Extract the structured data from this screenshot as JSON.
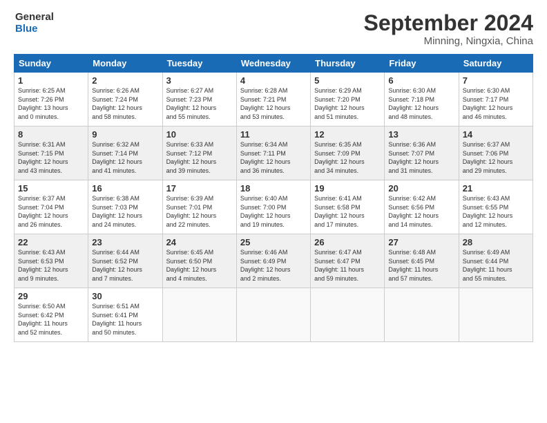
{
  "header": {
    "logo_line1": "General",
    "logo_line2": "Blue",
    "title": "September 2024",
    "location": "Minning, Ningxia, China"
  },
  "days_of_week": [
    "Sunday",
    "Monday",
    "Tuesday",
    "Wednesday",
    "Thursday",
    "Friday",
    "Saturday"
  ],
  "weeks": [
    [
      {
        "day": "1",
        "info": "Sunrise: 6:25 AM\nSunset: 7:26 PM\nDaylight: 13 hours\nand 0 minutes."
      },
      {
        "day": "2",
        "info": "Sunrise: 6:26 AM\nSunset: 7:24 PM\nDaylight: 12 hours\nand 58 minutes."
      },
      {
        "day": "3",
        "info": "Sunrise: 6:27 AM\nSunset: 7:23 PM\nDaylight: 12 hours\nand 55 minutes."
      },
      {
        "day": "4",
        "info": "Sunrise: 6:28 AM\nSunset: 7:21 PM\nDaylight: 12 hours\nand 53 minutes."
      },
      {
        "day": "5",
        "info": "Sunrise: 6:29 AM\nSunset: 7:20 PM\nDaylight: 12 hours\nand 51 minutes."
      },
      {
        "day": "6",
        "info": "Sunrise: 6:30 AM\nSunset: 7:18 PM\nDaylight: 12 hours\nand 48 minutes."
      },
      {
        "day": "7",
        "info": "Sunrise: 6:30 AM\nSunset: 7:17 PM\nDaylight: 12 hours\nand 46 minutes."
      }
    ],
    [
      {
        "day": "8",
        "info": "Sunrise: 6:31 AM\nSunset: 7:15 PM\nDaylight: 12 hours\nand 43 minutes."
      },
      {
        "day": "9",
        "info": "Sunrise: 6:32 AM\nSunset: 7:14 PM\nDaylight: 12 hours\nand 41 minutes."
      },
      {
        "day": "10",
        "info": "Sunrise: 6:33 AM\nSunset: 7:12 PM\nDaylight: 12 hours\nand 39 minutes."
      },
      {
        "day": "11",
        "info": "Sunrise: 6:34 AM\nSunset: 7:11 PM\nDaylight: 12 hours\nand 36 minutes."
      },
      {
        "day": "12",
        "info": "Sunrise: 6:35 AM\nSunset: 7:09 PM\nDaylight: 12 hours\nand 34 minutes."
      },
      {
        "day": "13",
        "info": "Sunrise: 6:36 AM\nSunset: 7:07 PM\nDaylight: 12 hours\nand 31 minutes."
      },
      {
        "day": "14",
        "info": "Sunrise: 6:37 AM\nSunset: 7:06 PM\nDaylight: 12 hours\nand 29 minutes."
      }
    ],
    [
      {
        "day": "15",
        "info": "Sunrise: 6:37 AM\nSunset: 7:04 PM\nDaylight: 12 hours\nand 26 minutes."
      },
      {
        "day": "16",
        "info": "Sunrise: 6:38 AM\nSunset: 7:03 PM\nDaylight: 12 hours\nand 24 minutes."
      },
      {
        "day": "17",
        "info": "Sunrise: 6:39 AM\nSunset: 7:01 PM\nDaylight: 12 hours\nand 22 minutes."
      },
      {
        "day": "18",
        "info": "Sunrise: 6:40 AM\nSunset: 7:00 PM\nDaylight: 12 hours\nand 19 minutes."
      },
      {
        "day": "19",
        "info": "Sunrise: 6:41 AM\nSunset: 6:58 PM\nDaylight: 12 hours\nand 17 minutes."
      },
      {
        "day": "20",
        "info": "Sunrise: 6:42 AM\nSunset: 6:56 PM\nDaylight: 12 hours\nand 14 minutes."
      },
      {
        "day": "21",
        "info": "Sunrise: 6:43 AM\nSunset: 6:55 PM\nDaylight: 12 hours\nand 12 minutes."
      }
    ],
    [
      {
        "day": "22",
        "info": "Sunrise: 6:43 AM\nSunset: 6:53 PM\nDaylight: 12 hours\nand 9 minutes."
      },
      {
        "day": "23",
        "info": "Sunrise: 6:44 AM\nSunset: 6:52 PM\nDaylight: 12 hours\nand 7 minutes."
      },
      {
        "day": "24",
        "info": "Sunrise: 6:45 AM\nSunset: 6:50 PM\nDaylight: 12 hours\nand 4 minutes."
      },
      {
        "day": "25",
        "info": "Sunrise: 6:46 AM\nSunset: 6:49 PM\nDaylight: 12 hours\nand 2 minutes."
      },
      {
        "day": "26",
        "info": "Sunrise: 6:47 AM\nSunset: 6:47 PM\nDaylight: 11 hours\nand 59 minutes."
      },
      {
        "day": "27",
        "info": "Sunrise: 6:48 AM\nSunset: 6:45 PM\nDaylight: 11 hours\nand 57 minutes."
      },
      {
        "day": "28",
        "info": "Sunrise: 6:49 AM\nSunset: 6:44 PM\nDaylight: 11 hours\nand 55 minutes."
      }
    ],
    [
      {
        "day": "29",
        "info": "Sunrise: 6:50 AM\nSunset: 6:42 PM\nDaylight: 11 hours\nand 52 minutes."
      },
      {
        "day": "30",
        "info": "Sunrise: 6:51 AM\nSunset: 6:41 PM\nDaylight: 11 hours\nand 50 minutes."
      },
      {
        "day": "",
        "info": ""
      },
      {
        "day": "",
        "info": ""
      },
      {
        "day": "",
        "info": ""
      },
      {
        "day": "",
        "info": ""
      },
      {
        "day": "",
        "info": ""
      }
    ]
  ]
}
